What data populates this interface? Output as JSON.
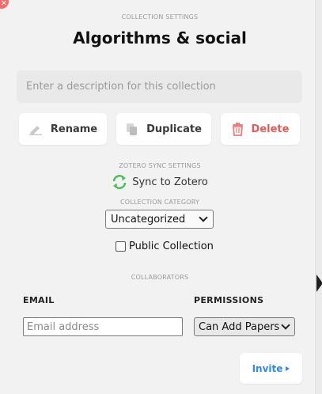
{
  "header": {
    "section_label": "COLLECTION SETTINGS",
    "title": "Algorithms & social"
  },
  "description": {
    "placeholder": "Enter a description for this collection",
    "value": ""
  },
  "actions": {
    "rename_label": "Rename",
    "duplicate_label": "Duplicate",
    "delete_label": "Delete"
  },
  "sync": {
    "section_label": "ZOTERO SYNC SETTINGS",
    "label": "Sync to Zotero",
    "icon": "sync-icon"
  },
  "category": {
    "section_label": "COLLECTION CATEGORY",
    "selected": "Uncategorized"
  },
  "public": {
    "label": "Public Collection",
    "checked": false
  },
  "collaborators": {
    "section_label": "COLLABORATORS",
    "email_header": "EMAIL",
    "permissions_header": "PERMISSIONS",
    "email_placeholder": "Email address",
    "email_value": "",
    "permission_selected": "Can Add Papers",
    "invite_label": "Invite"
  },
  "colors": {
    "accent": "#2e8ae6",
    "danger": "#e45a5a",
    "sync_green": "#4cbf5a",
    "close_red": "#f26b6b"
  }
}
